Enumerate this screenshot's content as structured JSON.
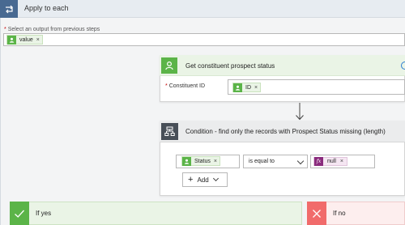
{
  "loop": {
    "title": "Apply to each",
    "select_label": "Select an output from previous steps",
    "required_mark": "*",
    "token": {
      "label": "value",
      "remove": "×",
      "icon": "dynamics-person-icon"
    }
  },
  "prospect_step": {
    "title": "Get constituent prospect status",
    "icon": "dynamics-person-icon",
    "field_label": "Constituent ID",
    "required_mark": "*",
    "token": {
      "label": "ID",
      "remove": "×"
    },
    "accent": "#5bb448"
  },
  "condition_step": {
    "title": "Condition - find only the records with Prospect Status missing (length)",
    "icon": "condition-icon",
    "left_token": {
      "label": "Status",
      "remove": "×"
    },
    "operator": "is equal to",
    "right_token": {
      "fx": "fx",
      "label": "null",
      "remove": "×"
    },
    "add_label": "Add"
  },
  "branches": {
    "yes": {
      "label": "If yes",
      "color": "#5bb448"
    },
    "no": {
      "label": "If no",
      "color": "#f16b6b"
    }
  }
}
